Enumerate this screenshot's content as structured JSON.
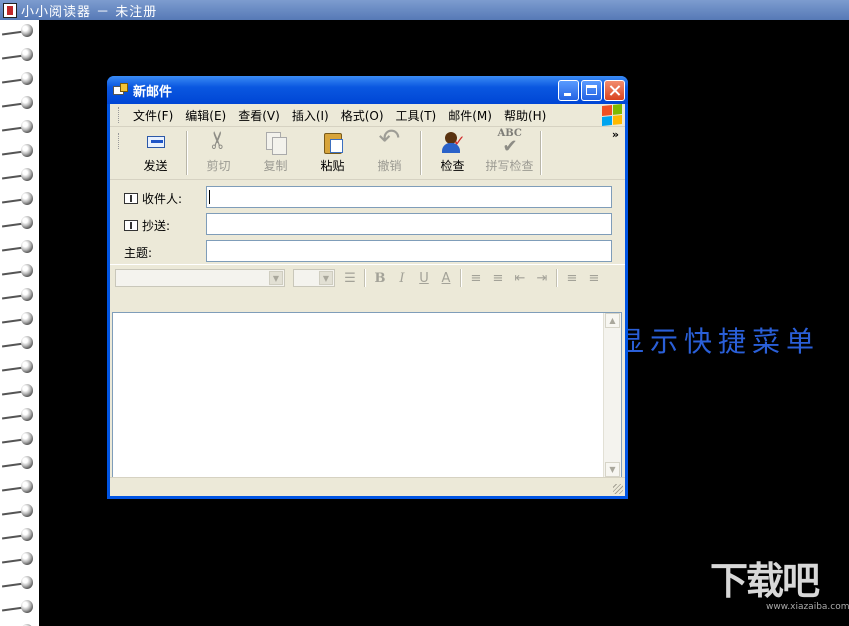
{
  "app": {
    "title": "小小阅读器 － 未注册"
  },
  "background": {
    "visible_text": "显示快捷菜单"
  },
  "watermark": {
    "logo": "下载吧",
    "site": "www.xiazaiba.com"
  },
  "window": {
    "title": "新邮件",
    "menu": [
      "文件(F)",
      "编辑(E)",
      "查看(V)",
      "插入(I)",
      "格式(O)",
      "工具(T)",
      "邮件(M)",
      "帮助(H)"
    ],
    "toolbar": {
      "send": "发送",
      "cut": "剪切",
      "copy": "复制",
      "paste": "粘贴",
      "undo": "撤销",
      "check": "检查",
      "spell": "拼写检查",
      "more": "»"
    },
    "fields": {
      "to_label": "收件人:",
      "to_value": "",
      "cc_label": "抄送:",
      "cc_value": "",
      "subject_label": "主题:",
      "subject_value": ""
    },
    "format": {
      "bold": "B",
      "italic": "I",
      "underline": "U",
      "font_color": "A"
    }
  },
  "colors": {
    "title_blue": "#0054e3",
    "window_face": "#ece9d8",
    "bg_text_blue": "#2a5fd8"
  }
}
